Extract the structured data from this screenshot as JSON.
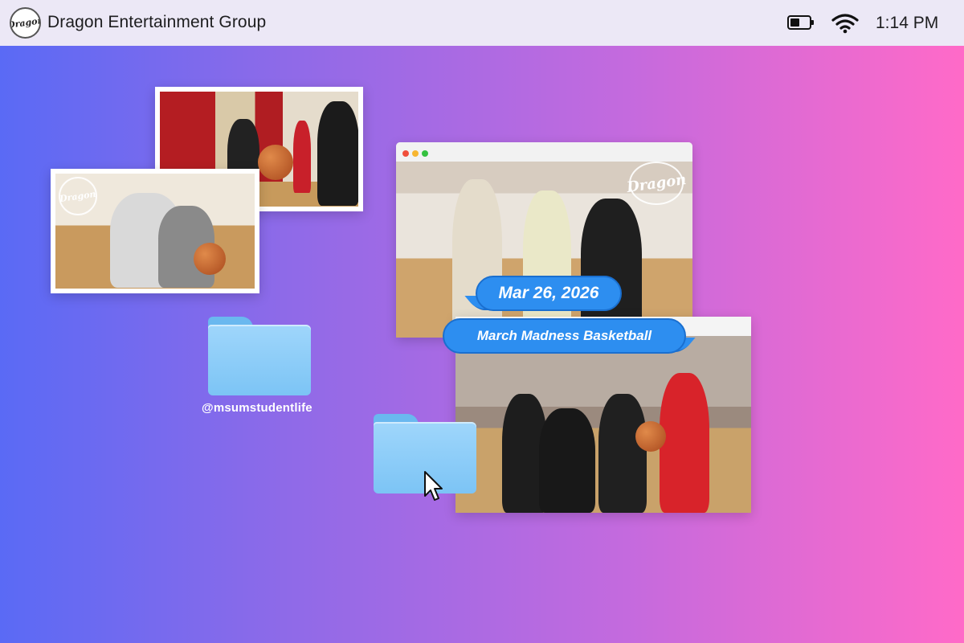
{
  "menubar": {
    "app_title": "Dragon Entertainment Group",
    "logo_text": "Dragon",
    "battery_icon": "battery-icon",
    "battery_level": 0.5,
    "wifi_icon": "wifi-icon",
    "clock": "1:14 PM"
  },
  "browser": {
    "controls": [
      "close",
      "minimize",
      "maximize"
    ],
    "watermark": "Dragon"
  },
  "bubbles": {
    "date": "Mar 26, 2026",
    "event_title": "March Madness Basketball"
  },
  "folders": [
    {
      "label": "@msumstudentlife"
    },
    {
      "label": ""
    }
  ],
  "photos": {
    "card_b_watermark": "Dragon"
  },
  "colors": {
    "bubble": "#2d8ef0",
    "folder": "#7cc4f5",
    "menubar": "#ece8f6",
    "gradient_left": "#5a6af5",
    "gradient_right": "#ff6ac8"
  }
}
